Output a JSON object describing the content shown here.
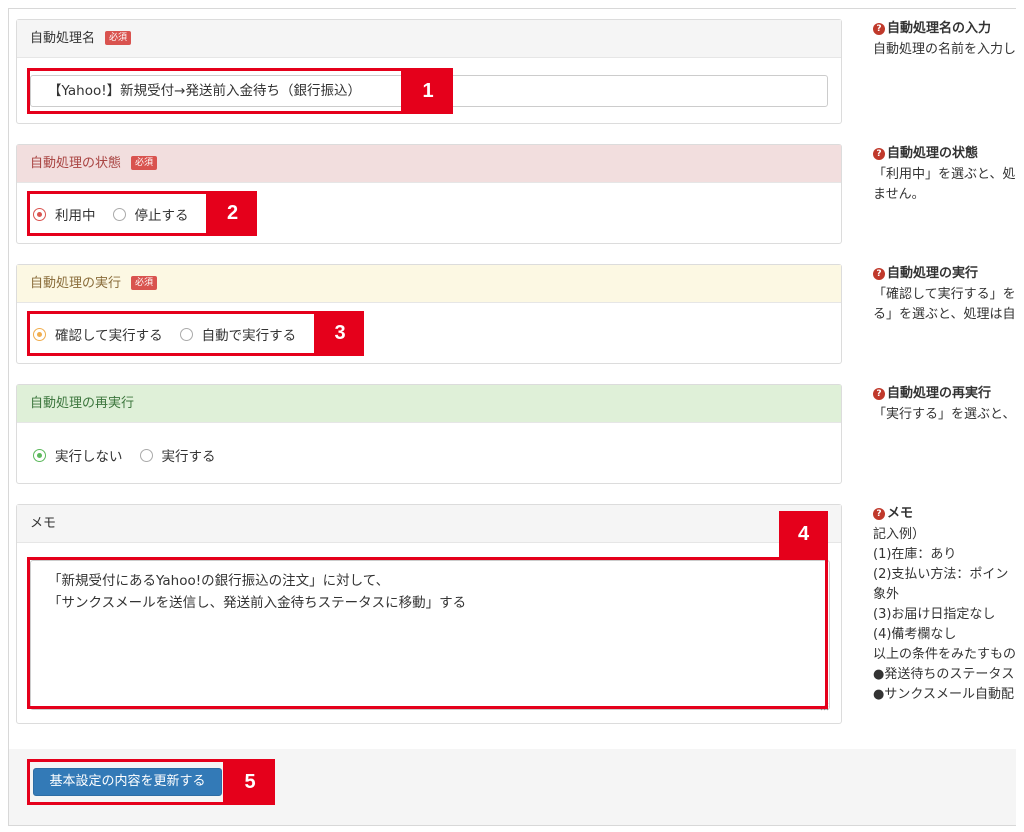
{
  "name_panel": {
    "title": "自動処理名",
    "badge": "必須",
    "value": "【Yahoo!】新規受付→発送前入金待ち（銀行振込）"
  },
  "status_panel": {
    "title": "自動処理の状態",
    "badge": "必須",
    "options": [
      "利用中",
      "停止する"
    ],
    "selected": "利用中"
  },
  "exec_panel": {
    "title": "自動処理の実行",
    "badge": "必須",
    "options": [
      "確認して実行する",
      "自動で実行する"
    ],
    "selected": "確認して実行する"
  },
  "rerun_panel": {
    "title": "自動処理の再実行",
    "options": [
      "実行しない",
      "実行する"
    ],
    "selected": "実行しない"
  },
  "memo_panel": {
    "title": "メモ",
    "value": "「新規受付にあるYahoo!の銀行振込の注文」に対して、\n「サンクスメールを送信し、発送前入金待ちステータスに移動」する"
  },
  "submit_label": "基本設定の内容を更新する",
  "callouts": [
    "1",
    "2",
    "3",
    "4",
    "5"
  ],
  "help": {
    "name_title": "自動処理名の入力",
    "name_text": "自動処理の名前を入力し",
    "status_title": "自動処理の状態",
    "status_text_1": "「利用中」を選ぶと、処",
    "status_text_2": "ません。",
    "exec_title": "自動処理の実行",
    "exec_text_1": "「確認して実行する」を",
    "exec_text_2": "る」を選ぶと、処理は自",
    "rerun_title": "自動処理の再実行",
    "rerun_text": "「実行する」を選ぶと、",
    "memo_title": "メモ",
    "memo_lines": [
      "記入例）",
      "(1)在庫：あり",
      "(2)支払い方法：ポイン",
      "象外",
      "(3)お届け日指定なし",
      "(4)備考欄なし",
      "以上の条件をみたすもの",
      "●発送待ちのステータス",
      "●サンクスメール自動配"
    ]
  },
  "colors": {
    "highlight": "#e5001b",
    "required_badge": "#d9534f",
    "submit": "#337ab7"
  }
}
